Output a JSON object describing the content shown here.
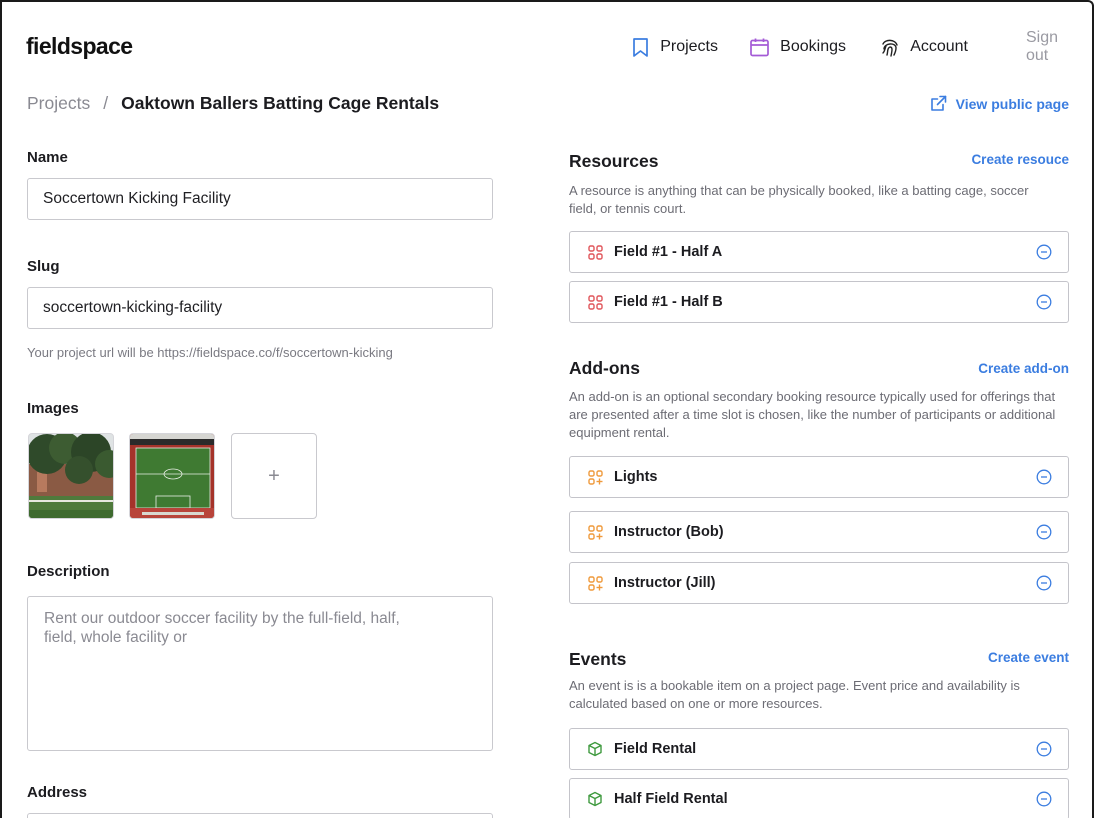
{
  "app": {
    "logo": "fieldspace"
  },
  "nav": {
    "projects": "Projects",
    "bookings": "Bookings",
    "account": "Account",
    "sign_out": "Sign out"
  },
  "breadcrumb": {
    "parent": "Projects",
    "separator": "/",
    "current": "Oaktown Ballers Batting Cage Rentals"
  },
  "view_public": "View public page",
  "form": {
    "name_label": "Name",
    "name_value": "Soccertown Kicking Facility",
    "slug_label": "Slug",
    "slug_value": "soccertown-kicking-facility",
    "slug_hint": "Your project url will be https://fieldspace.co/f/soccertown-kicking",
    "images_label": "Images",
    "add_image": "+",
    "description_label": "Description",
    "description_value": "Rent our outdoor soccer facility by the full-field, half, field, whole facility or",
    "address_label": "Address"
  },
  "resources": {
    "title": "Resources",
    "action": "Create resouce",
    "description": "A resource is anything that can be physically booked, like a batting cage, soccer field, or tennis court.",
    "items": [
      {
        "label": "Field #1 - Half A",
        "icon": "grid-icon"
      },
      {
        "label": "Field #1 - Half B",
        "icon": "grid-icon"
      }
    ]
  },
  "addons": {
    "title": "Add-ons",
    "action": "Create add-on",
    "description": "An add-on is an optional secondary booking resource typically used for offerings that are presented after a time slot is chosen, like the number of participants or additional equipment rental.",
    "items": [
      {
        "label": "Lights",
        "icon": "grid-plus-icon"
      },
      {
        "label": "Instructor (Bob)",
        "icon": "grid-plus-icon"
      },
      {
        "label": "Instructor (Jill)",
        "icon": "grid-plus-icon"
      }
    ]
  },
  "events": {
    "title": "Events",
    "action": "Create event",
    "description": "An event is is a bookable item on a project page. Event price and availability is calculated based on one or more resources.",
    "items": [
      {
        "label": "Field Rental",
        "icon": "cube-icon"
      },
      {
        "label": "Half Field Rental",
        "icon": "cube-icon"
      }
    ]
  },
  "colors": {
    "link": "#3b7de0",
    "resource_icon": "#e0565b",
    "addon_icon": "#ef9a3c",
    "event_icon": "#3f9a3f",
    "bookings_icon": "#a45bd6",
    "projects_icon": "#3b7de0"
  }
}
